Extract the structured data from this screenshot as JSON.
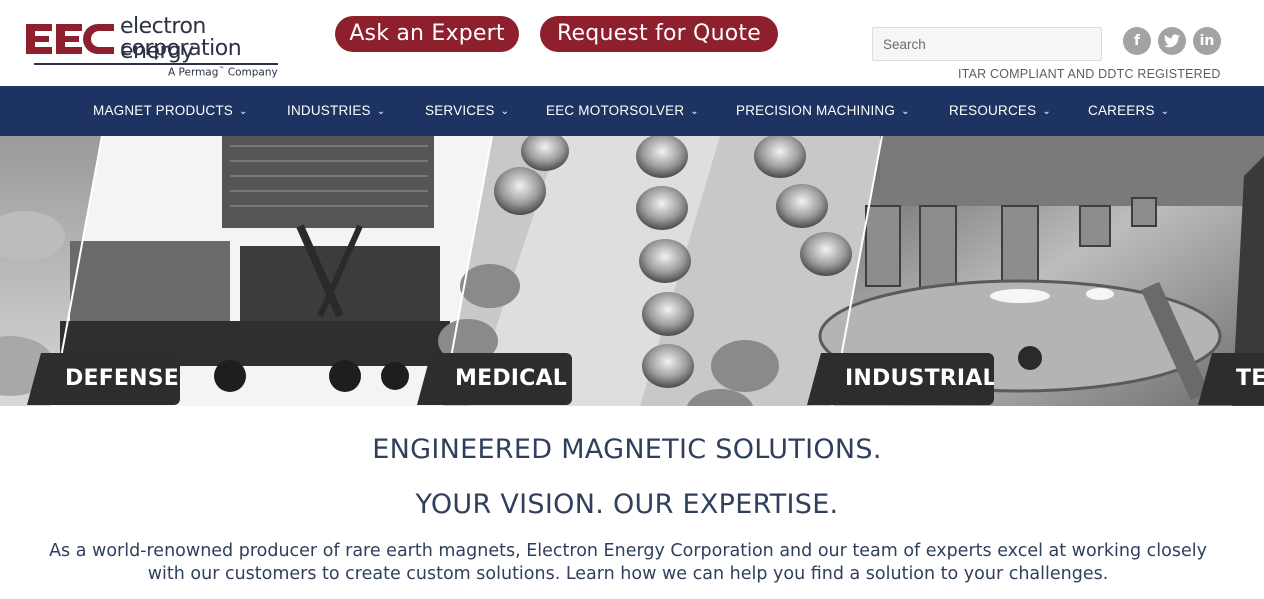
{
  "header": {
    "logo": {
      "mark": "EEC",
      "line1": "electron energy",
      "line2": "corporation",
      "tagline_prefix": "A Permag",
      "tagline_tm": "™",
      "tagline_suffix": " Company"
    },
    "ask_expert_label": "Ask an Expert",
    "request_quote_label": "Request for Quote",
    "search_placeholder": "Search",
    "social": {
      "facebook": "f",
      "twitter": "t",
      "linkedin": "in"
    },
    "compliance_text": "ITAR COMPLIANT AND DDTC REGISTERED"
  },
  "nav": {
    "items": [
      {
        "label": "MAGNET PRODUCTS"
      },
      {
        "label": "INDUSTRIES"
      },
      {
        "label": "SERVICES"
      },
      {
        "label": "EEC MOTORSOLVER"
      },
      {
        "label": "PRECISION MACHINING"
      },
      {
        "label": "RESOURCES"
      },
      {
        "label": "CAREERS"
      }
    ],
    "chevron": "⌄"
  },
  "hero": {
    "panels": [
      {
        "label": "DEFENSE"
      },
      {
        "label": "MEDICAL"
      },
      {
        "label": "INDUSTRIAL"
      },
      {
        "label": "TE"
      }
    ]
  },
  "main": {
    "headline1": "ENGINEERED MAGNETIC SOLUTIONS.",
    "headline2": "YOUR VISION. OUR EXPERTISE.",
    "intro": "As a world-renowned producer of rare earth magnets, Electron Energy Corporation and our team of experts excel at working closely with our customers to create custom solutions. Learn how we can help you find a solution to your challenges."
  },
  "colors": {
    "brand_red": "#8e1f2c",
    "nav_blue": "#1d3361",
    "text_navy": "#2f3f5c"
  }
}
